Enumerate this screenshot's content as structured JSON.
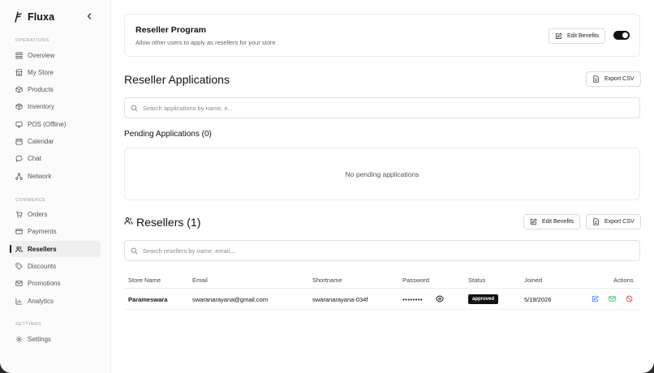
{
  "app": {
    "name": "Fluxa"
  },
  "sidebar": {
    "sections": [
      {
        "label": "OPERATIONS"
      },
      {
        "label": "COMMERCE"
      },
      {
        "label": "SETTINGS"
      }
    ],
    "items": [
      {
        "label": "Overview",
        "icon": "grid-icon"
      },
      {
        "label": "My Store",
        "icon": "store-icon"
      },
      {
        "label": "Products",
        "icon": "box-icon"
      },
      {
        "label": "Inventory",
        "icon": "package-icon"
      },
      {
        "label": "POS (Offline)",
        "icon": "monitor-icon"
      },
      {
        "label": "Calendar",
        "icon": "calendar-icon"
      },
      {
        "label": "Chat",
        "icon": "chat-icon"
      },
      {
        "label": "Network",
        "icon": "network-icon"
      },
      {
        "label": "Orders",
        "icon": "cart-icon"
      },
      {
        "label": "Payments",
        "icon": "credit-card-icon"
      },
      {
        "label": "Resellers",
        "icon": "users-icon",
        "active": true
      },
      {
        "label": "Discounts",
        "icon": "tag-icon"
      },
      {
        "label": "Promotions",
        "icon": "mail-icon"
      },
      {
        "label": "Analytics",
        "icon": "chart-icon"
      },
      {
        "label": "Settings",
        "icon": "gear-icon"
      }
    ]
  },
  "program": {
    "title": "Reseller Program",
    "description": "Allow other users to apply as resellers for your store",
    "edit_label": "Edit Benefits",
    "enabled": true
  },
  "applications": {
    "title": "Reseller Applications",
    "export_label": "Export CSV",
    "search_placeholder": "Search applications by name, e...",
    "pending_title": "Pending Applications (0)",
    "empty_text": "No pending applications"
  },
  "resellers": {
    "title": "Resellers (1)",
    "edit_label": "Edit Benefits",
    "export_label": "Export CSV",
    "search_placeholder": "Search resellers by name, email,...",
    "columns": [
      "Store Name",
      "Email",
      "Shortname",
      "Password",
      "Status",
      "Joined",
      "Actions"
    ],
    "rows": [
      {
        "store_name": "Parameswara",
        "email": "swaranarayana@gmail.com",
        "shortname": "swaranarayana-034f",
        "password": "••••••••",
        "status": "approved",
        "joined": "5/19/2026"
      }
    ]
  },
  "colors": {
    "accent": "#111111",
    "edit_action": "#3b82f6",
    "email_action": "#22c55e",
    "block_action": "#ef4444"
  }
}
